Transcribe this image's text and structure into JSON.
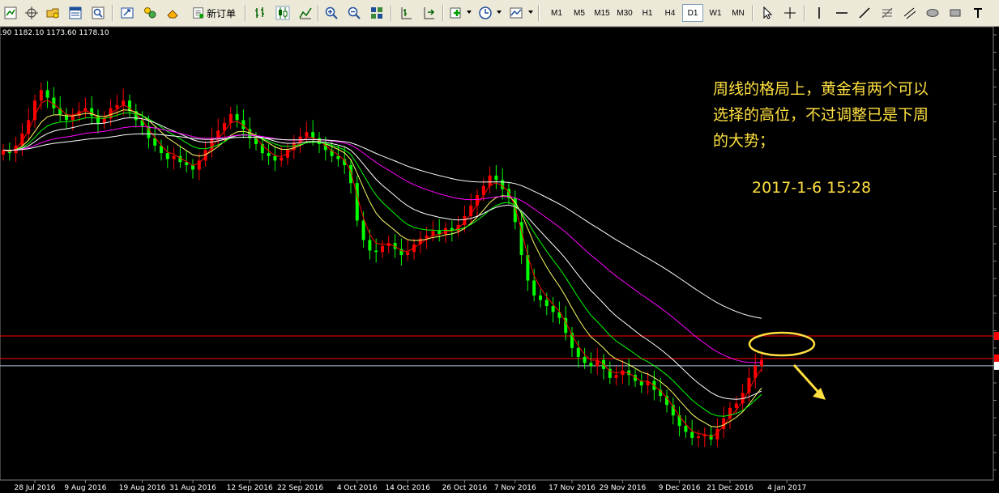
{
  "toolbar": {
    "new_order_label": "新订单",
    "timeframes": [
      "M1",
      "M5",
      "M15",
      "M30",
      "H1",
      "H4",
      "D1",
      "W1",
      "MN"
    ],
    "active_timeframe": "D1"
  },
  "ohlc_text": ".90 1182.10 1173.60 1178.10",
  "annotation": {
    "lines": [
      "周线的格局上，黄金有两个可以",
      "选择的高位，不过调整已是下周",
      "的大势；"
    ],
    "timestamp": "2017-1-6  15:28"
  },
  "colors": {
    "bull": "#ff0000",
    "bear": "#00ff00",
    "ma_red": "#ff0000",
    "ma_yellow": "#ffff66",
    "ma_green": "#00ff00",
    "ma_white_fast": "#ffffff",
    "ma_magenta": "#ff00ff",
    "ma_white_slow": "#ffffff",
    "hline": "#ff0000",
    "grid_line": "#b0c4de",
    "annotation": "#ffe040"
  },
  "chart_data": {
    "type": "candlestick",
    "x_tick_labels": [
      "28 Jul 2016",
      "9 Aug 2016",
      "19 Aug 2016",
      "31 Aug 2016",
      "12 Sep 2016",
      "22 Sep 2016",
      "4 Oct 2016",
      "14 Oct 2016",
      "26 Oct 2016",
      "7 Nov 2016",
      "17 Nov 2016",
      "29 Nov 2016",
      "9 Dec 2016",
      "21 Dec 2016",
      "4 Jan 2017"
    ],
    "candles_closes_approx": [
      1322,
      1320,
      1325,
      1333,
      1342,
      1355,
      1362,
      1357,
      1350,
      1346,
      1342,
      1345,
      1348,
      1350,
      1345,
      1340,
      1343,
      1350,
      1352,
      1355,
      1348,
      1342,
      1338,
      1330,
      1325,
      1320,
      1316,
      1318,
      1314,
      1312,
      1309,
      1315,
      1322,
      1330,
      1335,
      1340,
      1346,
      1342,
      1336,
      1330,
      1326,
      1320,
      1318,
      1315,
      1317,
      1322,
      1327,
      1331,
      1334,
      1330,
      1326,
      1322,
      1318,
      1316,
      1312,
      1300,
      1275,
      1262,
      1255,
      1254,
      1258,
      1260,
      1256,
      1252,
      1254,
      1259,
      1263,
      1265,
      1268,
      1266,
      1270,
      1268,
      1272,
      1278,
      1285,
      1292,
      1298,
      1305,
      1302,
      1296,
      1290,
      1274,
      1252,
      1235,
      1225,
      1222,
      1218,
      1214,
      1210,
      1200,
      1190,
      1184,
      1180,
      1178,
      1182,
      1176,
      1170,
      1172,
      1175,
      1172,
      1168,
      1165,
      1168,
      1162,
      1158,
      1152,
      1145,
      1138,
      1134,
      1130,
      1131,
      1132,
      1129,
      1136,
      1143,
      1150,
      1153,
      1160,
      1170,
      1178,
      1182
    ],
    "reference_price_levels": [
      "upper_red_hline",
      "lower_red_hline",
      "current_price_line"
    ],
    "annotations": [
      "yellow ellipse near upper red line",
      "yellow arrow pointing down-right"
    ]
  }
}
